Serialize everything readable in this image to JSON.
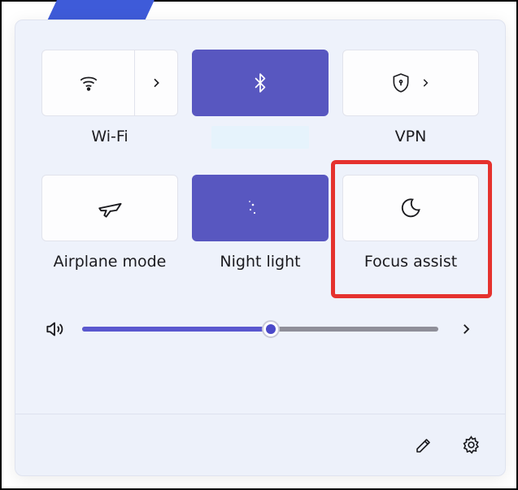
{
  "tiles": {
    "wifi": {
      "label": "Wi-Fi",
      "active": false
    },
    "bluetooth": {
      "label": "",
      "active": true
    },
    "vpn": {
      "label": "VPN",
      "active": false
    },
    "airplane": {
      "label": "Airplane mode",
      "active": false
    },
    "nightlight": {
      "label": "Night light",
      "active": true
    },
    "focus": {
      "label": "Focus assist",
      "active": false
    }
  },
  "slider": {
    "value": 53
  },
  "colors": {
    "accent": "#5857c0",
    "highlight": "#e5322e"
  }
}
